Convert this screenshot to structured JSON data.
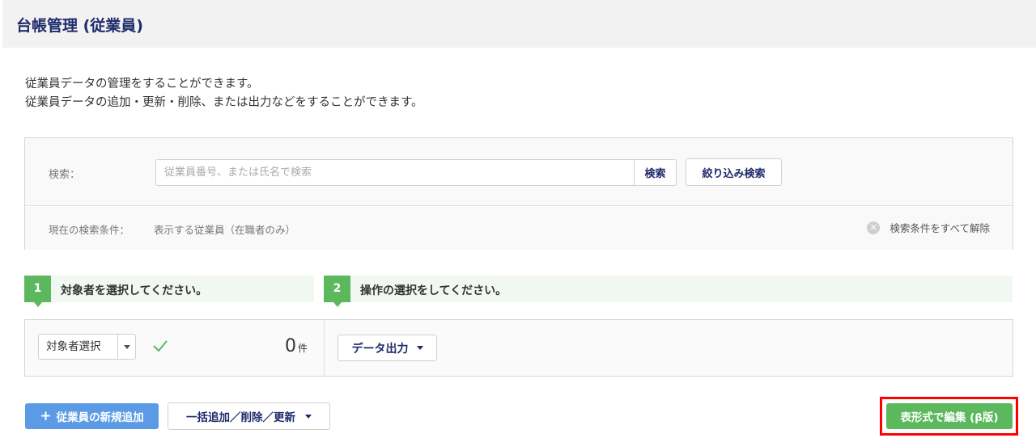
{
  "header": {
    "title": "台帳管理 (従業員)"
  },
  "description": {
    "line1": "従業員データの管理をすることができます。",
    "line2": "従業員データの追加・更新・削除、または出力などをすることができます。"
  },
  "search": {
    "label": "検索：",
    "placeholder": "従業員番号、または氏名で検索",
    "value": "",
    "search_button": "検索",
    "filter_button": "絞り込み検索",
    "current_condition_label": "現在の検索条件：",
    "current_condition_value": "表示する従業員（在職者のみ）",
    "clear_all": "検索条件をすべて解除"
  },
  "steps": [
    {
      "number": "1",
      "text": "対象者を選択してください。"
    },
    {
      "number": "2",
      "text": "操作の選択をしてください。"
    }
  ],
  "operation": {
    "target_select_label": "対象者選択",
    "count": "0",
    "count_unit": "件",
    "export_button": "データ出力"
  },
  "actions": {
    "add_employee": "従業員の新規追加",
    "bulk_ops": "一括追加／削除／更新",
    "table_edit": "表形式で編集 (β版)"
  },
  "colors": {
    "title": "#1f2b6b",
    "accent_green": "#5cb85c",
    "accent_blue": "#5b9be6",
    "highlight": "#ff0000"
  }
}
